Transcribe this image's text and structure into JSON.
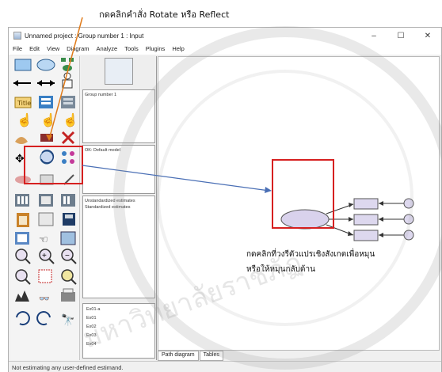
{
  "annotation_top": "กดคลิกคำสั่ง Rotate หรือ Reflect",
  "annotation_right": [
    "กดคลิกที่วงรีตัวแปรเชิงสังเกตเพื่อหมุน",
    "หรือให้หมุนกลับด้าน"
  ],
  "window": {
    "title": "Unnamed project : Group number 1 : Input",
    "controls": [
      "–",
      "☐",
      "✕"
    ]
  },
  "menu": [
    "File",
    "Edit",
    "View",
    "Diagram",
    "Analyze",
    "Tools",
    "Plugins",
    "Help"
  ],
  "panels": {
    "group": "Group number 1",
    "model": "OK: Default model",
    "estimates": [
      "Unstandardized estimates",
      "Standardized estimates"
    ]
  },
  "variables": [
    "Ex01-a",
    "Ex01",
    "Ex02",
    "Ex03",
    "Ex04"
  ],
  "tabs": [
    "Path diagram",
    "Tables"
  ],
  "status": "Not estimating any user-defined estimand.",
  "colors": {
    "highlight": "#d62020",
    "ellipse_fill": "#d9d2ec",
    "rect_fill": "#ddd8ee",
    "arrow": "#4a6fb5"
  },
  "watermark_text": "มหาวิทยาลัยราชภัฏ"
}
